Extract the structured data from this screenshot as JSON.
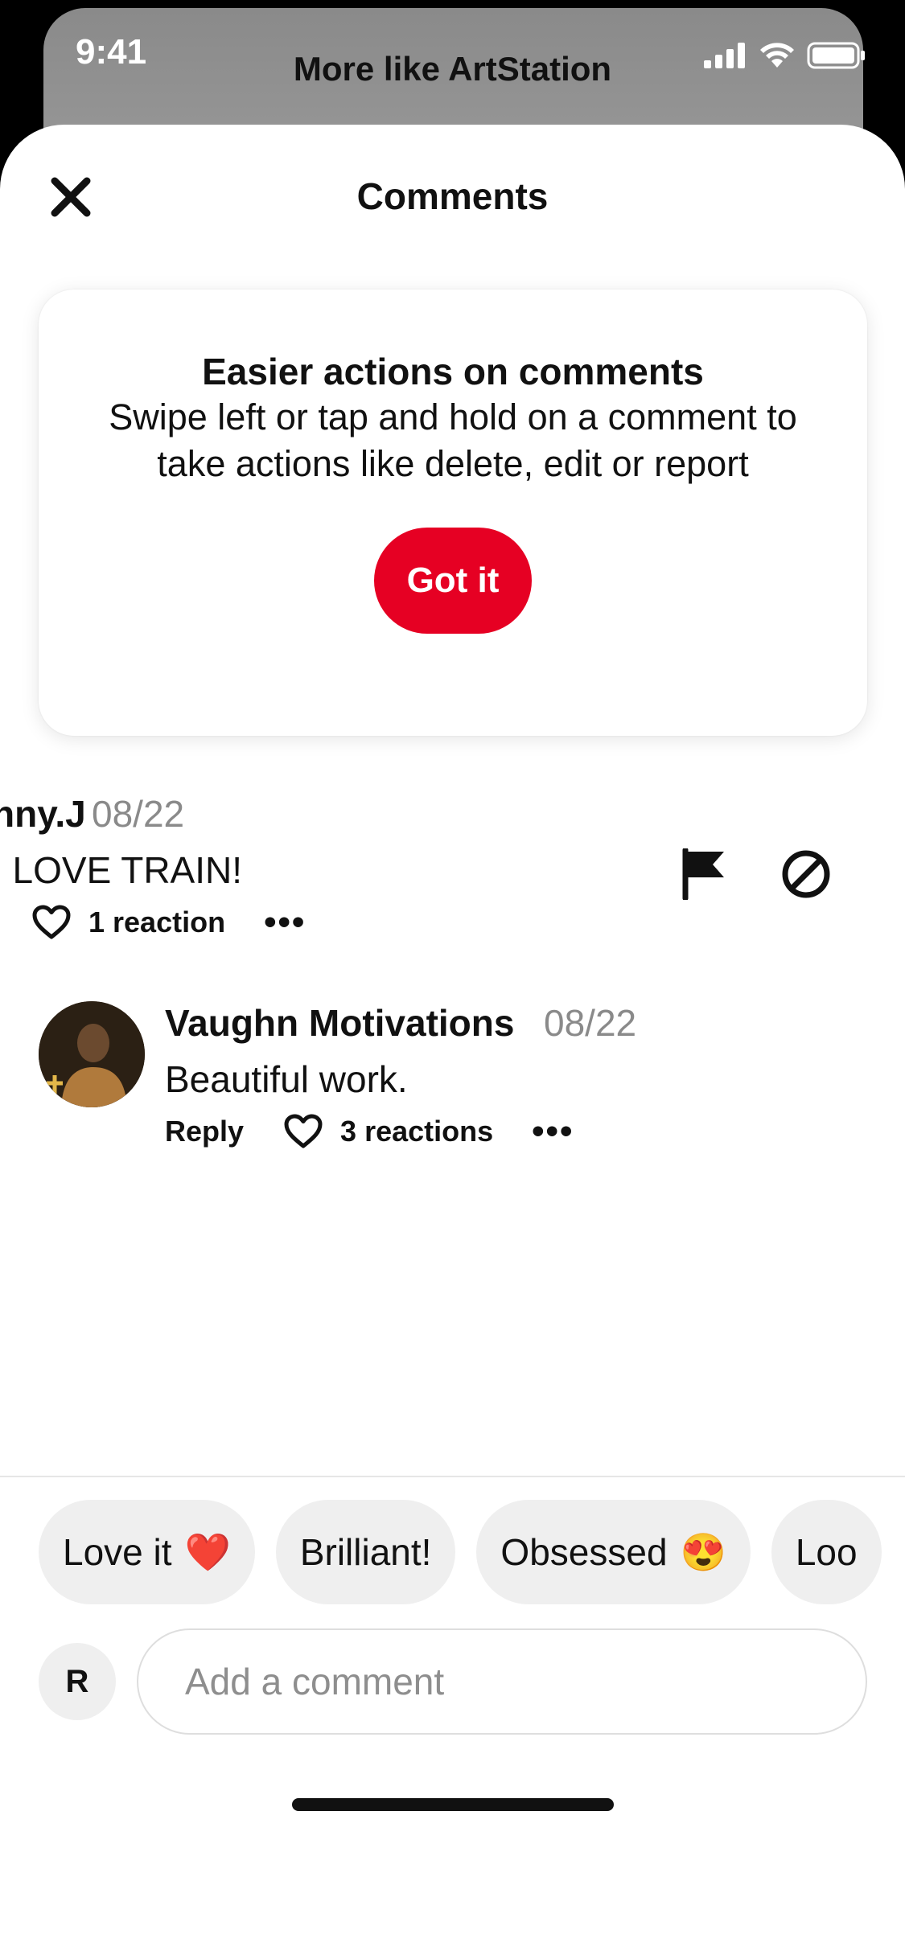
{
  "status_bar": {
    "time": "9:41"
  },
  "background_title": "More like ArtStation",
  "sheet": {
    "title": "Comments"
  },
  "tip": {
    "title": "Easier actions on comments",
    "body": "Swipe left or tap and hold on a comment to take actions like delete, edit or report",
    "button_label": "Got it"
  },
  "comments": [
    {
      "author": "nny.J",
      "date": "08/22",
      "text": ", LOVE TRAIN!",
      "reactions": "1 reaction"
    },
    {
      "author": "Vaughn Motivations",
      "date": "08/22",
      "text": "Beautiful work.",
      "reply_label": "Reply",
      "reactions": "3 reactions"
    }
  ],
  "quick_replies": [
    {
      "label": "Love it",
      "emoji": "❤️"
    },
    {
      "label": "Brilliant!",
      "emoji": ""
    },
    {
      "label": "Obsessed",
      "emoji": "😍"
    },
    {
      "label": "Loo",
      "emoji": ""
    }
  ],
  "composer": {
    "avatar_initial": "R",
    "placeholder": "Add a comment"
  },
  "colors": {
    "accent": "#e60023",
    "chip_bg": "#efefef",
    "muted_text": "#8a8a8a"
  }
}
